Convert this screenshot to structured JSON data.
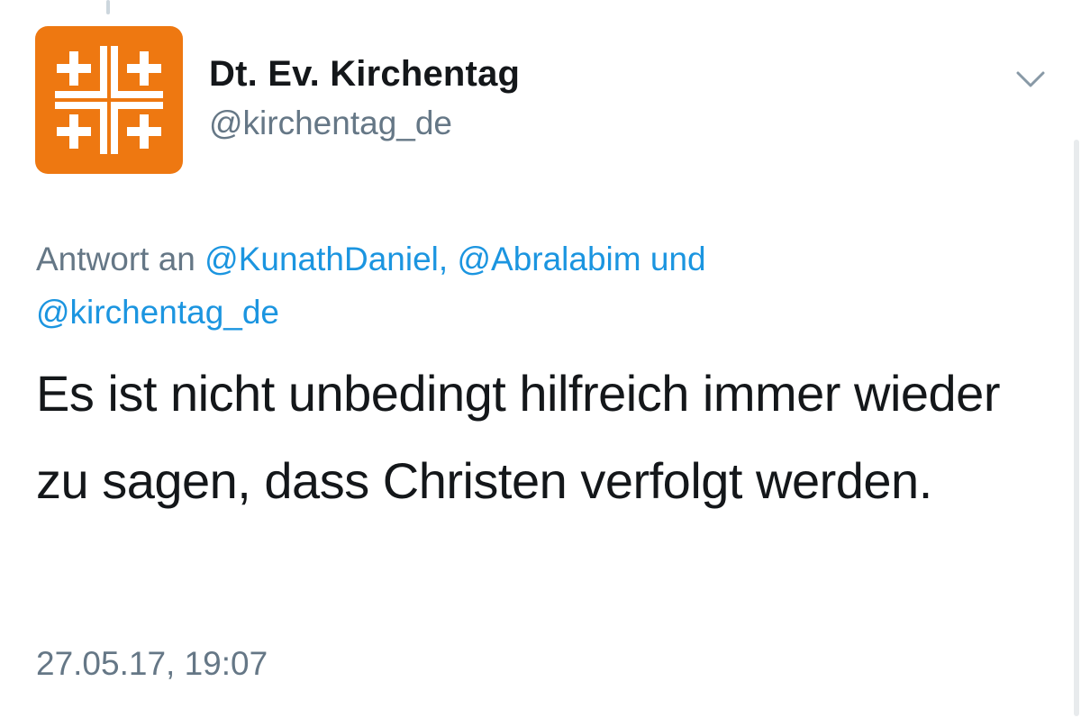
{
  "tweet": {
    "author": {
      "display_name": "Dt. Ev. Kirchentag",
      "handle": "@kirchentag_de",
      "avatar_icon": "jerusalem-cross-logo",
      "avatar_color": "#ee7811"
    },
    "reply_context": {
      "prefix": "Antwort an",
      "mentions": [
        "@KunathDaniel,",
        "@Abralabim",
        "@kirchentag_de"
      ],
      "conjunction": "und"
    },
    "text": "Es ist nicht unbedingt hilfreich immer wieder zu sagen, dass Christen verfolgt werden.",
    "timestamp": "27.05.17, 19:07",
    "menu_icon": "chevron-down-icon"
  },
  "colors": {
    "mention": "#1b95e0",
    "secondary_text": "#657786",
    "primary_text": "#14171a"
  }
}
